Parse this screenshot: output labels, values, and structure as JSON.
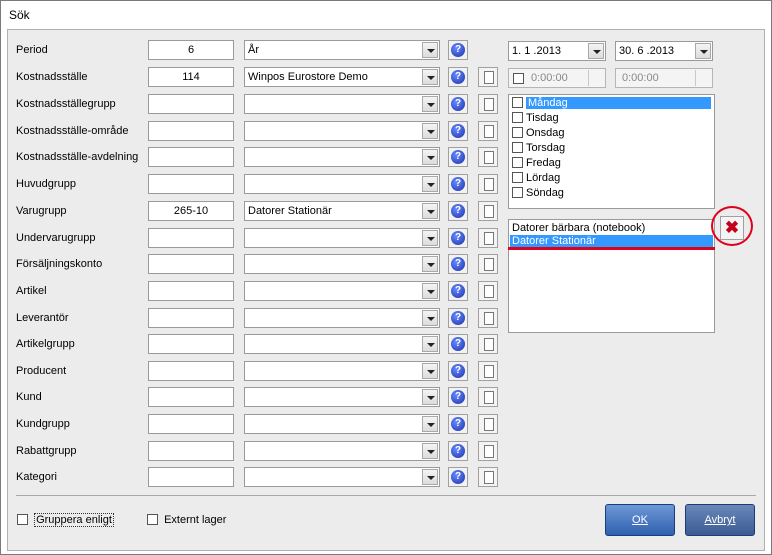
{
  "window": {
    "title": "Sök"
  },
  "rows": [
    {
      "label": "Period",
      "code": "6",
      "combo": "År",
      "doc": false
    },
    {
      "label": "Kostnadsställe",
      "code": "114",
      "combo": "Winpos Eurostore Demo",
      "doc": true
    },
    {
      "label": "Kostnadsställegrupp",
      "code": "",
      "combo": "",
      "doc": true
    },
    {
      "label": "Kostnadsställe-område",
      "code": "",
      "combo": "",
      "doc": true
    },
    {
      "label": "Kostnadsställe-avdelning",
      "code": "",
      "combo": "",
      "doc": true
    },
    {
      "label": "Huvudgrupp",
      "code": "",
      "combo": "",
      "doc": true
    },
    {
      "label": "Varugrupp",
      "code": "265-10",
      "combo": "Datorer Stationär",
      "doc": true
    },
    {
      "label": "Undervarugrupp",
      "code": "",
      "combo": "",
      "doc": true
    },
    {
      "label": "Försäljningskonto",
      "code": "",
      "combo": "",
      "doc": true
    },
    {
      "label": "Artikel",
      "code": "",
      "combo": "",
      "doc": true
    },
    {
      "label": "Leverantör",
      "code": "",
      "combo": "",
      "doc": true
    },
    {
      "label": "Artikelgrupp",
      "code": "",
      "combo": "",
      "doc": true
    },
    {
      "label": "Producent",
      "code": "",
      "combo": "",
      "doc": true
    },
    {
      "label": "Kund",
      "code": "",
      "combo": "",
      "doc": true
    },
    {
      "label": "Kundgrupp",
      "code": "",
      "combo": "",
      "doc": true
    },
    {
      "label": "Rabattgrupp",
      "code": "",
      "combo": "",
      "doc": true
    },
    {
      "label": "Kategori",
      "code": "",
      "combo": "",
      "doc": true
    }
  ],
  "dates": {
    "from": "1. 1 .2013",
    "to": "30. 6 .2013"
  },
  "times": {
    "from": "0:00:00",
    "to": "0:00:00"
  },
  "weekdays": [
    "Måndag",
    "Tisdag",
    "Onsdag",
    "Torsdag",
    "Fredag",
    "Lördag",
    "Söndag"
  ],
  "selected_weekday": "Måndag",
  "selection_list": [
    "Datorer bärbara (notebook)",
    "Datorer Stationär"
  ],
  "selected_item": "Datorer Stationär",
  "help_glyph": "?",
  "remove_glyph": "✖",
  "footer": {
    "group_label": "Gruppera enligt",
    "external_label": "Externt lager",
    "ok": "OK",
    "cancel": "Avbryt"
  },
  "colors": {
    "accent": "#3399ff",
    "button": "#2f5fb0",
    "highlight": "#e0001c"
  }
}
